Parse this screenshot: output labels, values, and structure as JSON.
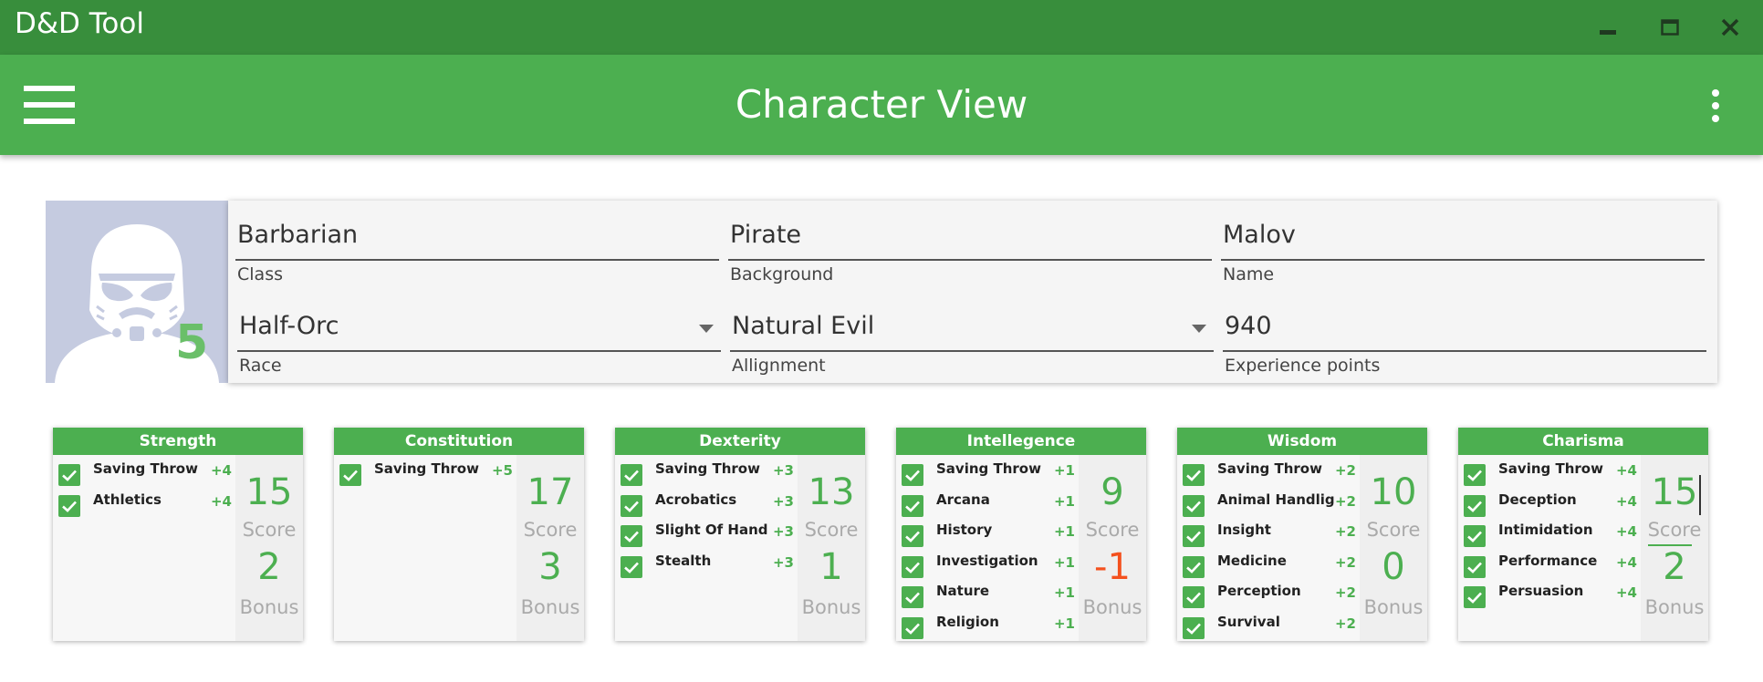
{
  "window": {
    "title": "D&D Tool",
    "controls": [
      "minimize-icon",
      "maximize-icon",
      "close-icon"
    ]
  },
  "appbar": {
    "title": "Character View",
    "menu_icon": "hamburger-menu-icon",
    "more_icon": "more-vert-icon"
  },
  "character": {
    "level": "5",
    "avatar_icon": "stormtrooper-avatar-icon",
    "class": {
      "value": "Barbarian",
      "label": "Class"
    },
    "background": {
      "value": "Pirate",
      "label": "Background"
    },
    "name": {
      "value": "Malov",
      "label": "Name"
    },
    "race": {
      "value": "Half-Orc",
      "label": "Race"
    },
    "alignment": {
      "value": "Natural Evil",
      "label": "Allignment"
    },
    "xp": {
      "value": "940",
      "label": "Experience points"
    }
  },
  "labels": {
    "score": "Score",
    "bonus": "Bonus"
  },
  "colors": {
    "accent": "#4caf50",
    "title_bar": "#388e3c",
    "negative": "#f4511e"
  },
  "abilities": [
    {
      "name": "Strength",
      "score": "15",
      "bonus": "2",
      "skills": [
        {
          "name": "Saving Throw",
          "mod": "+4",
          "checked": true
        },
        {
          "name": "Athletics",
          "mod": "+4",
          "checked": true
        }
      ]
    },
    {
      "name": "Constitution",
      "score": "17",
      "bonus": "3",
      "skills": [
        {
          "name": "Saving Throw",
          "mod": "+5",
          "checked": true
        }
      ]
    },
    {
      "name": "Dexterity",
      "score": "13",
      "bonus": "1",
      "skills": [
        {
          "name": "Saving Throw",
          "mod": "+3",
          "checked": true
        },
        {
          "name": "Acrobatics",
          "mod": "+3",
          "checked": true
        },
        {
          "name": "Slight Of Hand",
          "mod": "+3",
          "checked": true
        },
        {
          "name": "Stealth",
          "mod": "+3",
          "checked": true
        }
      ]
    },
    {
      "name": "Intellegence",
      "score": "9",
      "bonus": "-1",
      "skills": [
        {
          "name": "Saving Throw",
          "mod": "+1",
          "checked": true
        },
        {
          "name": "Arcana",
          "mod": "+1",
          "checked": true
        },
        {
          "name": "History",
          "mod": "+1",
          "checked": true
        },
        {
          "name": "Investigation",
          "mod": "+1",
          "checked": true
        },
        {
          "name": "Nature",
          "mod": "+1",
          "checked": true
        },
        {
          "name": "Religion",
          "mod": "+1",
          "checked": true
        }
      ]
    },
    {
      "name": "Wisdom",
      "score": "10",
      "bonus": "0",
      "skills": [
        {
          "name": "Saving Throw",
          "mod": "+2",
          "checked": true
        },
        {
          "name": "Animal Handlig",
          "mod": "+2",
          "checked": true
        },
        {
          "name": "Insight",
          "mod": "+2",
          "checked": true
        },
        {
          "name": "Medicine",
          "mod": "+2",
          "checked": true
        },
        {
          "name": "Perception",
          "mod": "+2",
          "checked": true
        },
        {
          "name": "Survival",
          "mod": "+2",
          "checked": true
        }
      ]
    },
    {
      "name": "Charisma",
      "score": "15",
      "bonus": "2",
      "focused": true,
      "skills": [
        {
          "name": "Saving Throw",
          "mod": "+4",
          "checked": true
        },
        {
          "name": "Deception",
          "mod": "+4",
          "checked": true
        },
        {
          "name": "Intimidation",
          "mod": "+4",
          "checked": true
        },
        {
          "name": "Performance",
          "mod": "+4",
          "checked": true
        },
        {
          "name": "Persuasion",
          "mod": "+4",
          "checked": true
        }
      ]
    }
  ]
}
